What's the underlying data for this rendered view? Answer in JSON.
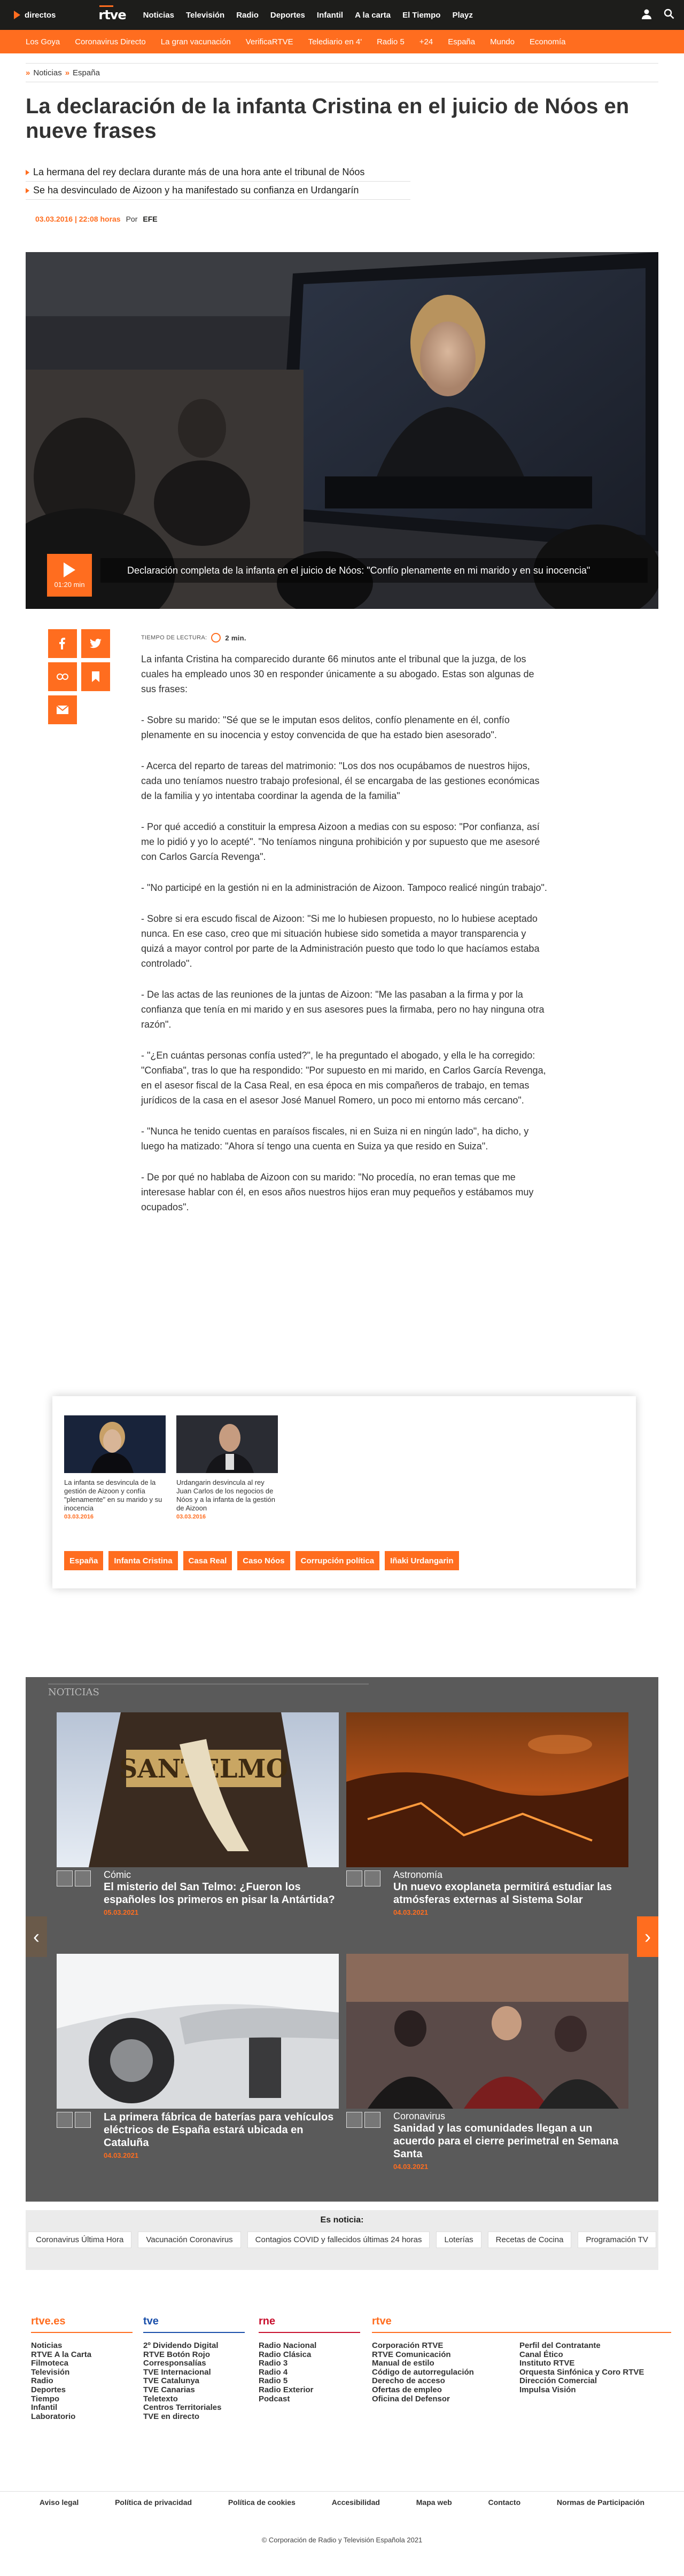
{
  "topbar": {
    "directos": "directos",
    "logo": "rtve",
    "nav": [
      "Noticias",
      "Televisión",
      "Radio",
      "Deportes",
      "Infantil",
      "A la carta",
      "El Tiempo",
      "Playz"
    ]
  },
  "subnav": [
    "Los Goya",
    "Coronavirus Directo",
    "La gran vacunación",
    "VerificaRTVE",
    "Telediario en 4'",
    "Radio 5",
    "+24",
    "España",
    "Mundo",
    "Economía"
  ],
  "breadcrumb": {
    "part1": "Noticias",
    "part2": "España"
  },
  "article": {
    "title": "La declaración de la infanta Cristina en el juicio de Nóos en nueve frases",
    "summary": [
      "La hermana del rey declara durante más de una hora ante el tribunal de Nóos",
      "Se ha desvinculado de Aizoon y ha manifestado su confianza en Urdangarín"
    ],
    "date": "03.03.2016 | 22:08 horas",
    "by": "Por",
    "source": "EFE",
    "video_duration": "01:20 min",
    "video_caption": "Declaración completa de la infanta en el juicio de Nóos: \"Confío plenamente en mi marido y en su inocencia\"",
    "read_label": "TIEMPO DE LECTURA:",
    "read_value": "2 min.",
    "paragraphs": [
      "La infanta Cristina ha comparecido durante 66 minutos ante el tribunal que la juzga, de los cuales ha empleado unos 30 en responder únicamente a su abogado. Estas son algunas de sus frases:",
      "- Sobre su marido: \"Sé que se le imputan esos delitos, confío plenamente en él, confío plenamente en su inocencia y estoy convencida de que ha estado bien asesorado\".",
      "- Acerca del reparto de tareas del matrimonio: \"Los dos nos ocupábamos de nuestros hijos, cada uno teníamos nuestro trabajo profesional, él se encargaba de las gestiones económicas de la familia y yo intentaba coordinar la agenda de la familia\"",
      "- Por qué accedió a constituir la empresa Aizoon a medias con su esposo: \"Por confianza, así me lo pidió y yo lo acepté\". \"No teníamos ninguna prohibición y por supuesto que me asesoré con Carlos García Revenga\".",
      "- \"No participé en la gestión ni en la administración de Aizoon. Tampoco realicé ningún trabajo\".",
      "- Sobre si era escudo fiscal de Aizoon: \"Si me lo hubiesen propuesto, no lo hubiese aceptado nunca. En ese caso, creo que mi situación hubiese sido sometida a mayor transparencia y quizá a mayor control por parte de la Administración puesto que todo lo que hacíamos estaba controlado\".",
      "- De las actas de las reuniones de la juntas de Aizoon: \"Me las pasaban a la firma y por la confianza que tenía en mi marido y en sus asesores pues la firmaba, pero no hay ninguna otra razón\".",
      "- \"¿En cuántas personas confía usted?\", le ha preguntado el abogado, y ella le ha corregido: \"Confiaba\", tras lo que ha respondido: \"Por supuesto en mi marido, en Carlos García Revenga, en el asesor fiscal de la Casa Real, en esa época en mis compañeros de trabajo, en temas jurídicos de la casa en el asesor José Manuel Romero, un poco mi entorno más cercano\".",
      "- \"Nunca he tenido cuentas en paraísos fiscales, ni en Suiza ni en ningún lado\", ha dicho, y luego ha matizado: \"Ahora sí tengo una cuenta en Suiza ya que resido en Suiza\".",
      "- De por qué no hablaba de Aizoon con su marido: \"No procedía, no eran temas que me interesase hablar con él, en esos años nuestros hijos eran muy pequeños y estábamos muy ocupados\"."
    ]
  },
  "related": {
    "items": [
      {
        "text": "La infanta se desvincula de la gestión de Aizoon y confía \"plenamente\" en su marido y su inocencia",
        "date": "03.03.2016"
      },
      {
        "text": "Urdangarin desvincula al rey Juan Carlos de los negocios de Nóos y a la infanta de la gestión de Aizoon",
        "date": "03.03.2016"
      }
    ],
    "tags": [
      "España",
      "Infanta Cristina",
      "Casa Real",
      "Caso Nóos",
      "Corrupción política",
      "Iñaki Urdangarin"
    ]
  },
  "news": {
    "label": "NOTICIAS",
    "cards": [
      {
        "cat": "Cómic",
        "head": "El misterio del San Telmo: ¿Fueron los españoles los primeros en pisar la Antártida?",
        "date": "05.03.2021"
      },
      {
        "cat": "Astronomía",
        "head": "Un nuevo exoplaneta permitirá estudiar las atmósferas externas al Sistema Solar",
        "date": "04.03.2021"
      },
      {
        "cat": "",
        "head": "La primera fábrica de baterías para vehículos eléctricos de España estará ubicada en Cataluña",
        "date": "04.03.2021"
      },
      {
        "cat": "Coronavirus",
        "head": "Sanidad y las comunidades llegan a un acuerdo para el cierre perimetral en Semana Santa",
        "date": "04.03.2021"
      }
    ],
    "image_text": "SANTELMO"
  },
  "es_noticia": {
    "title": "Es noticia:",
    "chips": [
      "Coronavirus Última Hora",
      "Vacunación Coronavirus",
      "Contagios COVID y fallecidos últimas 24 horas",
      "Loterías",
      "Recetas de Cocina",
      "Programación TV"
    ]
  },
  "footer": {
    "col1": {
      "logo": "rtve.es",
      "links": [
        "Noticias",
        "RTVE A la Carta",
        "Filmoteca",
        "Televisión",
        "Radio",
        "Deportes",
        "Tiempo",
        "Infantil",
        "Laboratorio"
      ]
    },
    "col2": {
      "logo": "tve",
      "links": [
        "2º Dividendo Digital",
        "RTVE Botón Rojo",
        "Corresponsalías",
        "TVE Internacional",
        "TVE Catalunya",
        "TVE Canarias",
        "Teletexto",
        "Centros Territoriales",
        "TVE en directo"
      ]
    },
    "col3": {
      "logo": "rne",
      "links": [
        "Radio Nacional",
        "Radio Clásica",
        "Radio 3",
        "Radio 4",
        "Radio 5",
        "Radio Exterior",
        "Podcast"
      ]
    },
    "col4": {
      "logo": "rtve",
      "links": [
        "Corporación RTVE",
        "RTVE Comunicación",
        "Manual de estilo",
        "Código de autorregulación",
        "Derecho de acceso",
        "Ofertas de empleo",
        "Oficina del Defensor"
      ]
    },
    "col5": {
      "links": [
        "Perfil del Contratante",
        "Canal Ético",
        "Instituto RTVE",
        "Orquesta Sinfónica y Coro RTVE",
        "Dirección Comercial",
        "Impulsa Visión"
      ]
    },
    "bottom": [
      "Aviso legal",
      "Política de privacidad",
      "Política de cookies",
      "Accesibilidad",
      "Mapa web",
      "Contacto",
      "Normas de Participación"
    ],
    "copyright": "© Corporación de Radio y Televisión Española 2021"
  }
}
